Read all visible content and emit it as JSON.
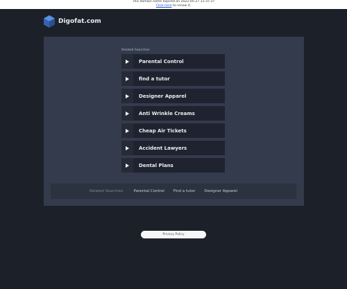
{
  "notice": {
    "line1": "This domain name expired on 2022-05-27 12:37:37",
    "link": "Click here",
    "line2_suffix": " to renew it."
  },
  "brand": {
    "name": "Digofat.com",
    "logo_icon": "cube-icon"
  },
  "related_label": "Related Searches:",
  "links": [
    "Parental Control",
    "find a tutor",
    "Designer Apparel",
    "Anti Wrinkle Creams",
    "Cheap Air Tickets",
    "Accident Lawyers",
    "Dental Plans"
  ],
  "footer": {
    "label": "Related Searches:",
    "links": [
      "Parental Control",
      "Find a tutor",
      "Designer Apparel"
    ]
  },
  "privacy_label": "Privacy Policy",
  "colors": {
    "background": "#1c2028",
    "panel": "#333b4c",
    "link_bg": "#1f2330",
    "logo": "#3f6fc2"
  }
}
